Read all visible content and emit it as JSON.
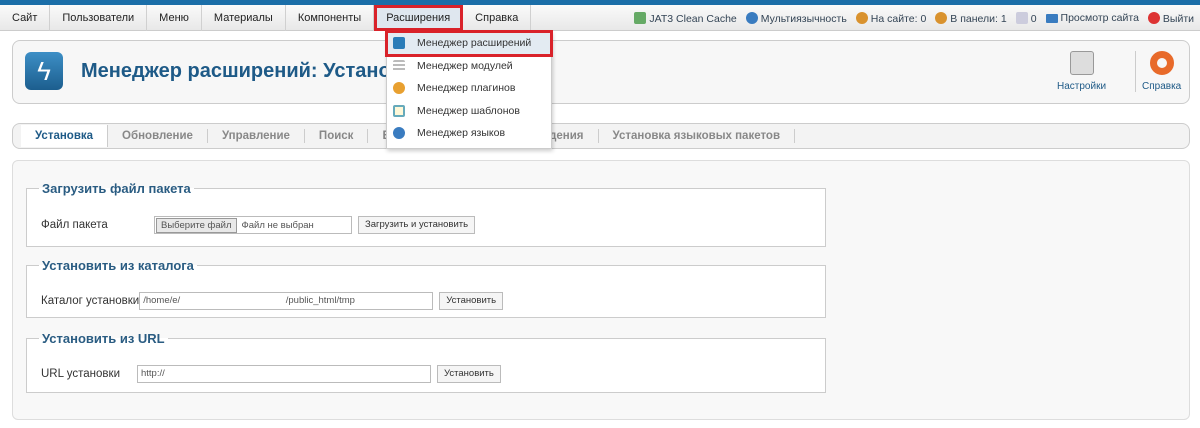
{
  "menu": {
    "items": [
      "Сайт",
      "Пользователи",
      "Меню",
      "Материалы",
      "Компоненты",
      "Расширения",
      "Справка"
    ],
    "active_index": 5
  },
  "status": {
    "cache": "JAT3 Clean Cache",
    "multilang": "Мультиязычность",
    "on_site": "На сайте: 0",
    "in_panel": "В панели: 1",
    "messages": "0",
    "view_site": "Просмотр сайта",
    "logout": "Выйти"
  },
  "header": {
    "title": "Менеджер расширений: Установка",
    "options_label": "Настройки",
    "help_label": "Справка"
  },
  "tabs": [
    "Установка",
    "Обновление",
    "Управление",
    "Поиск",
    "База данных",
    "Предупреждения",
    "Установка языковых пакетов"
  ],
  "dropdown": [
    "Менеджер расширений",
    "Менеджер модулей",
    "Менеджер плагинов",
    "Менеджер шаблонов",
    "Менеджер языков"
  ],
  "upload": {
    "legend": "Загрузить файл пакета",
    "label": "Файл пакета",
    "choose": "Выберите файл",
    "no_file": "Файл не выбран",
    "button": "Загрузить и установить"
  },
  "folder": {
    "legend": "Установить из каталога",
    "label": "Каталог установки",
    "value": "/home/e/                                        /public_html/tmp",
    "button": "Установить"
  },
  "url": {
    "legend": "Установить из URL",
    "label": "URL установки",
    "value": "http://",
    "button": "Установить"
  }
}
